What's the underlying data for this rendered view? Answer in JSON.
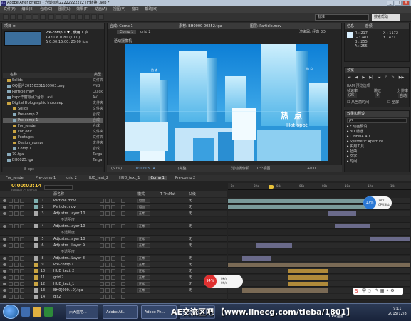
{
  "window": {
    "title": "Adobe After Effects - 六博标点22222222222 [已转换].aep *",
    "app_icon": "Ae",
    "controls": [
      "_",
      "□",
      "X"
    ]
  },
  "menu": [
    "文件(F)",
    "编辑(E)",
    "合成(C)",
    "图层(L)",
    "效果(T)",
    "动画(A)",
    "视图(V)",
    "窗口",
    "帮助(H)"
  ],
  "toolbar": {
    "workspace": "标准",
    "search_placeholder": "搜索帮助"
  },
  "project": {
    "tab": "项目 ≡",
    "comp_name": "Pre-comp 1 ▼ , 使用 1 次",
    "comp_size": "1920 x 1080 (1.00)",
    "comp_duration": "Δ 0:00:15:00, 25.00 fps",
    "col_name": "名称",
    "col_type": "类型",
    "items": [
      {
        "name": "Solids",
        "type": "文件夹",
        "indent": 0,
        "folder": true
      },
      {
        "name": "QQ图片20150331100903.png",
        "type": "PNG",
        "indent": 0,
        "folder": false
      },
      {
        "name": "Particle.mov",
        "type": "Quick",
        "indent": 0,
        "folder": false
      },
      {
        "name": "hspc华窗标点2台标 Lavi",
        "type": "AVI",
        "indent": 0,
        "folder": false
      },
      {
        "name": "Digital Holographic Intro.aep",
        "type": "文件夹",
        "indent": 0,
        "folder": true
      },
      {
        "name": "Solids",
        "type": "文件夹",
        "indent": 1,
        "folder": true
      },
      {
        "name": "Pre-comp 2",
        "type": "合成",
        "indent": 1,
        "folder": false
      },
      {
        "name": "Pre-comp 1",
        "type": "合成",
        "indent": 1,
        "folder": false,
        "selected": true
      },
      {
        "name": "For_render",
        "type": "合成",
        "indent": 1,
        "folder": true
      },
      {
        "name": "For_edit",
        "type": "文件夹",
        "indent": 1,
        "folder": true
      },
      {
        "name": "Footages",
        "type": "文件夹",
        "indent": 1,
        "folder": true
      },
      {
        "name": "Design_comps",
        "type": "文件夹",
        "indent": 1,
        "folder": true
      },
      {
        "name": "Comp 1",
        "type": "合成",
        "indent": 1,
        "folder": false
      },
      {
        "name": "70.tga",
        "type": "Targa",
        "indent": 0,
        "folder": false
      },
      {
        "name": "BH0025.tga",
        "type": "Targa",
        "indent": 0,
        "folder": false
      }
    ],
    "footer": "8 bpc"
  },
  "composition": {
    "tab": "合成: Comp 1",
    "footage_tab": "素材: BH0000-00252.tga",
    "layer_tab": "图层: Particle.mov",
    "breadcrumb": [
      "Comp 1",
      "grid 2"
    ],
    "renderer": "渲染器: 经典 3D",
    "camera_label": "活动摄像机",
    "zoom": "(50%)",
    "timecode": "0:00:03:14",
    "quality": "(完整)",
    "view": "活动摄像机",
    "views": "1 个视图",
    "exposure": "+0.0",
    "overlay_cn": "热 点",
    "overlay_en": "Hot spot",
    "small_label1": "热 点",
    "small_label2": "热 点"
  },
  "info": {
    "tab": "信息",
    "tab2": "音频",
    "r": "R : 217",
    "g": "G : 240",
    "b": "B : 255",
    "a": "A : 255",
    "x": "X : 1172",
    "y": "Y : 471"
  },
  "preview": {
    "tab": "预览",
    "ram": "RAM 预览选项",
    "framerate_label": "帧速率",
    "skip_label": "跳过",
    "resolution_label": "分辨率",
    "framerate": "(25)",
    "skip": "0",
    "resolution": "自动",
    "from_current": "从当前时间",
    "fullscreen": "全屏"
  },
  "effects": {
    "tab": "效果和预设",
    "search_placeholder": "ρ▾",
    "items": [
      "* 动画预设",
      "3D 通道",
      "CINEMA 4D",
      "Synthetic Aperture",
      "实用工具",
      "扭曲",
      "文字",
      "时间"
    ]
  },
  "timeline": {
    "tabs": [
      "For_render",
      "Pre-comp 1",
      "grid 2",
      "HUD_text_2",
      "HUD_text_1",
      "Comp 1",
      "Pre-comp 2"
    ],
    "active_tab": "Comp 1",
    "timecode": "0:00:03:14",
    "fps": "00089 (25.00 fps)",
    "col_source": "源名称",
    "col_mode": "模式",
    "col_trkmat": "T TrkMat",
    "col_parent": "父级",
    "ruler": [
      "0s",
      "02s",
      "04s",
      "06s",
      "08s",
      "10s",
      "12s",
      "14s"
    ],
    "layers": [
      {
        "num": "1",
        "name": "Particle.mov",
        "mode": "相加",
        "parent": "无",
        "bar": [
          0,
          195
        ],
        "color": "#7a9a9a",
        "chip": "#7fb0b0"
      },
      {
        "num": "2",
        "name": "Particle.mov",
        "mode": "相加",
        "parent": "无",
        "bar": [
          0,
          195
        ],
        "color": "#7a9a9a",
        "chip": "#7fb0b0"
      },
      {
        "num": "3",
        "name": "Adjustm...ayer 10",
        "mode": "正常",
        "parent": "无",
        "bar": [
          140,
          180
        ],
        "color": "#6a6a8a",
        "chip": "#aaa"
      },
      {
        "num": "",
        "name": "不透明度",
        "mode": "",
        "parent": "",
        "bar": null,
        "color": "",
        "chip": "",
        "sub": true
      },
      {
        "num": "4",
        "name": "Adjustm...ayer 10",
        "mode": "正常",
        "parent": "无",
        "bar": [
          150,
          200
        ],
        "color": "#6a6a8a",
        "chip": "#aaa"
      },
      {
        "num": "",
        "name": "不透明度",
        "mode": "",
        "parent": "",
        "bar": null,
        "color": "",
        "chip": "",
        "sub": true
      },
      {
        "num": "5",
        "name": "Adjustm...ayer 10",
        "mode": "正常",
        "parent": "无",
        "bar": [
          200,
          255
        ],
        "color": "#6a6a8a",
        "chip": "#aaa"
      },
      {
        "num": "6",
        "name": "Adjustm...Layer 9",
        "mode": "正常",
        "parent": "无",
        "bar": [
          40,
          90
        ],
        "color": "#6a6a8a",
        "chip": "#aaa"
      },
      {
        "num": "",
        "name": "不透明度",
        "mode": "",
        "parent": "",
        "bar": null,
        "color": "",
        "chip": "",
        "sub": true
      },
      {
        "num": "8",
        "name": "Adjustm...Layer 8",
        "mode": "正常",
        "parent": "无",
        "bar": [
          20,
          60
        ],
        "color": "#6a6a8a",
        "chip": "#aaa"
      },
      {
        "num": "9",
        "name": "Pre-comp 1",
        "mode": "正常",
        "parent": "无",
        "bar": [
          0,
          255
        ],
        "color": "#7a6a55",
        "chip": "#c9a441"
      },
      {
        "num": "10",
        "name": "HUD_text_2",
        "mode": "正常",
        "parent": "无",
        "bar": [
          85,
          140
        ],
        "color": "#b08a3a",
        "chip": "#c9a441"
      },
      {
        "num": "11",
        "name": "grid 2",
        "mode": "正常",
        "parent": "无",
        "bar": [
          85,
          140
        ],
        "color": "#b08a3a",
        "chip": "#c9a441"
      },
      {
        "num": "12",
        "name": "HUD_text_1",
        "mode": "正常",
        "parent": "无",
        "bar": [
          85,
          140
        ],
        "color": "#b08a3a",
        "chip": "#c9a441"
      },
      {
        "num": "13",
        "name": "BH0[000...0].tga",
        "mode": "正常",
        "parent": "无",
        "bar": [
          20,
          140
        ],
        "color": "#7a6a55",
        "chip": "#aaa"
      },
      {
        "num": "14",
        "name": "dis2",
        "mode": "",
        "parent": "",
        "bar": null,
        "color": "",
        "chip": "#aaa"
      }
    ]
  },
  "cpu_widget_1": {
    "percent": "17%",
    "temp": "28°C",
    "label": "CPU温度"
  },
  "cpu_widget_2": {
    "percent": "94%",
    "up": "0K/s",
    "down": "0K/s"
  },
  "taskbar": {
    "buttons": [
      "六大蓝吧...",
      "Adobe Af...",
      "Adobe Ph...",
      "[作业]...",
      "CPU温度"
    ],
    "watermark": "AE交流区吧  【www.linecg.com/tieba/1801】",
    "time": "9:11",
    "date": "2015/12/8"
  },
  "colors": {
    "accent": "#f0c53d",
    "cti": "#e02020",
    "sky": "#1e8ee0"
  }
}
